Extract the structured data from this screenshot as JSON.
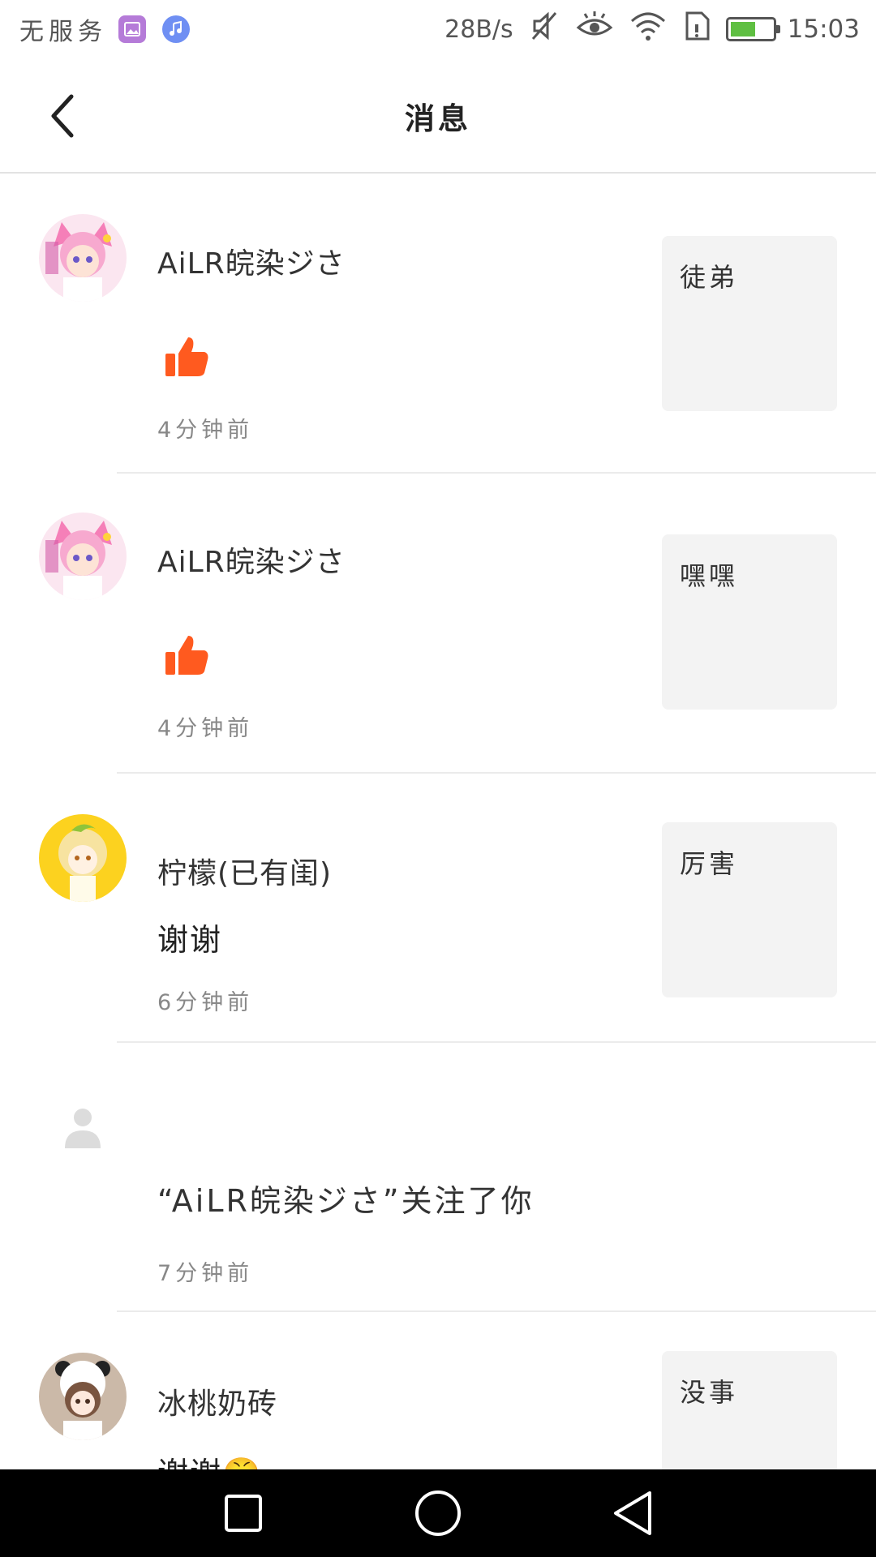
{
  "status_bar": {
    "carrier": "无服务",
    "net_speed": "28B/s",
    "time": "15:03",
    "battery_level": 0.6,
    "accent_battery": "#5fbf42"
  },
  "header": {
    "title": "消息",
    "back_icon": "chevron-left-icon"
  },
  "messages": [
    {
      "type": "like",
      "name": "AiLR皖染ジさ",
      "icon": "thumbs-up-icon",
      "time": "4分钟前",
      "preview": "徒弟"
    },
    {
      "type": "like",
      "name": "AiLR皖染ジさ",
      "icon": "thumbs-up-icon",
      "time": "4分钟前",
      "preview": "嘿嘿"
    },
    {
      "type": "reply",
      "name": "柠檬(已有闺)",
      "text": "谢谢",
      "time": "6分钟前",
      "preview": "厉害"
    },
    {
      "type": "follow",
      "text": "“AiLR皖染ジさ”关注了你",
      "time": "7分钟前"
    },
    {
      "type": "reply",
      "name": "冰桃奶砖",
      "text": "谢谢😤",
      "time": "",
      "preview": "没事"
    }
  ],
  "colors": {
    "like": "#ff5a1f",
    "preview_bg": "#f3f3f3",
    "divider": "#ebebeb"
  },
  "nav_bar": {
    "recent_icon": "square-icon",
    "home_icon": "circle-icon",
    "back_icon": "triangle-back-icon"
  }
}
